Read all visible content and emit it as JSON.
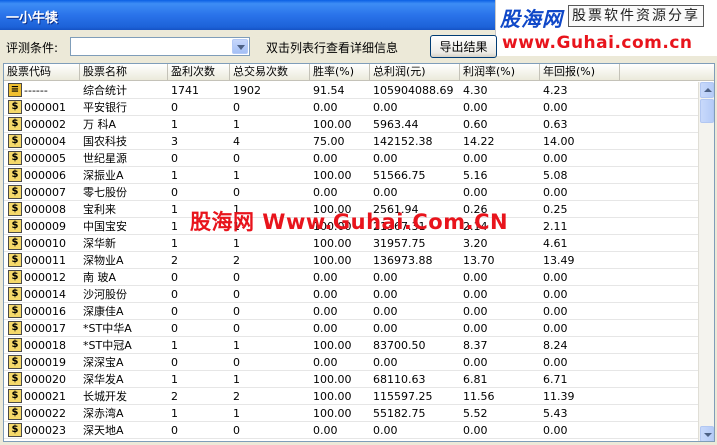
{
  "window": {
    "title": "一小牛犊"
  },
  "logo": {
    "name_cn": "股海网",
    "slogan": "股票软件资源分享",
    "url": "www.Guhai.com.cn"
  },
  "toolbar": {
    "condition_label": "评测条件:",
    "condition_value": "",
    "hint": "双击列表行查看详细信息",
    "export_label": "导出结果"
  },
  "table": {
    "columns": [
      "股票代码",
      "股票名称",
      "盈利次数",
      "总交易次数",
      "胜率(%)",
      "总利润(元)",
      "利润率(%)",
      "年回报(%)"
    ],
    "rows": [
      [
        "------",
        "综合统计",
        "1741",
        "1902",
        "91.54",
        "105904088.69",
        "4.30",
        "4.23"
      ],
      [
        "000001",
        "平安银行",
        "0",
        "0",
        "0.00",
        "0.00",
        "0.00",
        "0.00"
      ],
      [
        "000002",
        "万 科A",
        "1",
        "1",
        "100.00",
        "5963.44",
        "0.60",
        "0.63"
      ],
      [
        "000004",
        "国农科技",
        "3",
        "4",
        "75.00",
        "142152.38",
        "14.22",
        "14.00"
      ],
      [
        "000005",
        "世纪星源",
        "0",
        "0",
        "0.00",
        "0.00",
        "0.00",
        "0.00"
      ],
      [
        "000006",
        "深振业A",
        "1",
        "1",
        "100.00",
        "51566.75",
        "5.16",
        "5.08"
      ],
      [
        "000007",
        "零七股份",
        "0",
        "0",
        "0.00",
        "0.00",
        "0.00",
        "0.00"
      ],
      [
        "000008",
        "宝利来",
        "1",
        "1",
        "100.00",
        "2561.94",
        "0.26",
        "0.25"
      ],
      [
        "000009",
        "中国宝安",
        "1",
        "1",
        "100.00",
        "21367.31",
        "2.14",
        "2.11"
      ],
      [
        "000010",
        "深华新",
        "1",
        "1",
        "100.00",
        "31957.75",
        "3.20",
        "4.61"
      ],
      [
        "000011",
        "深物业A",
        "2",
        "2",
        "100.00",
        "136973.88",
        "13.70",
        "13.49"
      ],
      [
        "000012",
        "南 玻A",
        "0",
        "0",
        "0.00",
        "0.00",
        "0.00",
        "0.00"
      ],
      [
        "000014",
        "沙河股份",
        "0",
        "0",
        "0.00",
        "0.00",
        "0.00",
        "0.00"
      ],
      [
        "000016",
        "深康佳A",
        "0",
        "0",
        "0.00",
        "0.00",
        "0.00",
        "0.00"
      ],
      [
        "000017",
        "*ST中华A",
        "0",
        "0",
        "0.00",
        "0.00",
        "0.00",
        "0.00"
      ],
      [
        "000018",
        "*ST中冠A",
        "1",
        "1",
        "100.00",
        "83700.50",
        "8.37",
        "8.24"
      ],
      [
        "000019",
        "深深宝A",
        "0",
        "0",
        "0.00",
        "0.00",
        "0.00",
        "0.00"
      ],
      [
        "000020",
        "深华发A",
        "1",
        "1",
        "100.00",
        "68110.63",
        "6.81",
        "6.71"
      ],
      [
        "000021",
        "长城开发",
        "2",
        "2",
        "100.00",
        "115597.25",
        "11.56",
        "11.39"
      ],
      [
        "000022",
        "深赤湾A",
        "1",
        "1",
        "100.00",
        "55182.75",
        "5.52",
        "5.43"
      ],
      [
        "000023",
        "深天地A",
        "0",
        "0",
        "0.00",
        "0.00",
        "0.00",
        "0.00"
      ]
    ]
  },
  "watermark": "股海网 Www.Guhai.Com.CN",
  "icons": {
    "row_icon": "dollar-doc-icon",
    "summary_icon": "folder-doc-icon"
  },
  "colors": {
    "title_bar": "#2a73ea",
    "logo_blue": "#1048c8",
    "logo_red": "#e8141c"
  }
}
